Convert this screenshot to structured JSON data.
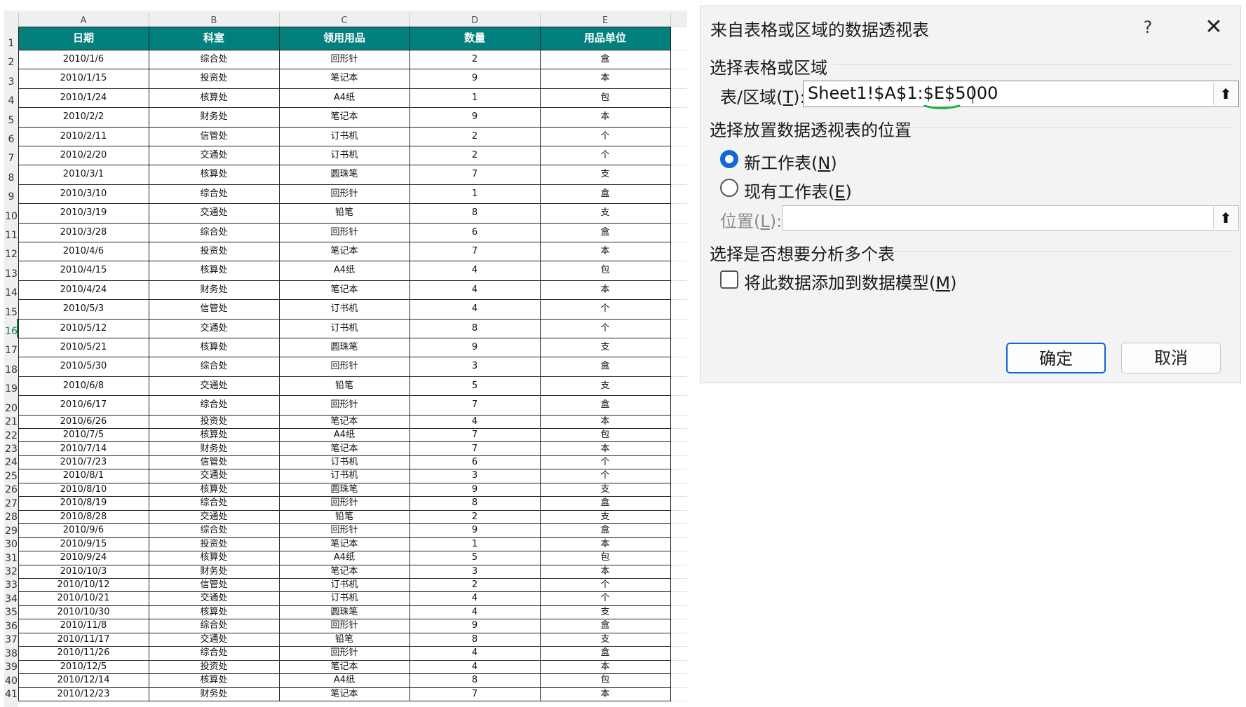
{
  "sheet": {
    "columns": [
      "A",
      "B",
      "C",
      "D",
      "E"
    ],
    "header": [
      "日期",
      "科室",
      "领用用品",
      "数量",
      "用品单位"
    ],
    "rows": [
      [
        "2010/1/6",
        "综合处",
        "回形针",
        "2",
        "盒"
      ],
      [
        "2010/1/15",
        "投资处",
        "笔记本",
        "9",
        "本"
      ],
      [
        "2010/1/24",
        "核算处",
        "A4纸",
        "1",
        "包"
      ],
      [
        "2010/2/2",
        "财务处",
        "笔记本",
        "9",
        "本"
      ],
      [
        "2010/2/11",
        "信管处",
        "订书机",
        "2",
        "个"
      ],
      [
        "2010/2/20",
        "交通处",
        "订书机",
        "2",
        "个"
      ],
      [
        "2010/3/1",
        "核算处",
        "圆珠笔",
        "7",
        "支"
      ],
      [
        "2010/3/10",
        "综合处",
        "回形针",
        "1",
        "盒"
      ],
      [
        "2010/3/19",
        "交通处",
        "铅笔",
        "8",
        "支"
      ],
      [
        "2010/3/28",
        "综合处",
        "回形针",
        "6",
        "盒"
      ],
      [
        "2010/4/6",
        "投资处",
        "笔记本",
        "7",
        "本"
      ],
      [
        "2010/4/15",
        "核算处",
        "A4纸",
        "4",
        "包"
      ],
      [
        "2010/4/24",
        "财务处",
        "笔记本",
        "4",
        "本"
      ],
      [
        "2010/5/3",
        "信管处",
        "订书机",
        "4",
        "个"
      ],
      [
        "2010/5/12",
        "交通处",
        "订书机",
        "8",
        "个"
      ],
      [
        "2010/5/21",
        "核算处",
        "圆珠笔",
        "9",
        "支"
      ],
      [
        "2010/5/30",
        "综合处",
        "回形针",
        "3",
        "盒"
      ],
      [
        "2010/6/8",
        "交通处",
        "铅笔",
        "5",
        "支"
      ],
      [
        "2010/6/17",
        "综合处",
        "回形针",
        "7",
        "盒"
      ],
      [
        "2010/6/26",
        "投资处",
        "笔记本",
        "4",
        "本"
      ],
      [
        "2010/7/5",
        "核算处",
        "A4纸",
        "7",
        "包"
      ],
      [
        "2010/7/14",
        "财务处",
        "笔记本",
        "7",
        "本"
      ],
      [
        "2010/7/23",
        "信管处",
        "订书机",
        "6",
        "个"
      ],
      [
        "2010/8/1",
        "交通处",
        "订书机",
        "3",
        "个"
      ],
      [
        "2010/8/10",
        "核算处",
        "圆珠笔",
        "9",
        "支"
      ],
      [
        "2010/8/19",
        "综合处",
        "回形针",
        "8",
        "盒"
      ],
      [
        "2010/8/28",
        "交通处",
        "铅笔",
        "2",
        "支"
      ],
      [
        "2010/9/6",
        "综合处",
        "回形针",
        "9",
        "盒"
      ],
      [
        "2010/9/15",
        "投资处",
        "笔记本",
        "1",
        "本"
      ],
      [
        "2010/9/24",
        "核算处",
        "A4纸",
        "5",
        "包"
      ],
      [
        "2010/10/3",
        "财务处",
        "笔记本",
        "3",
        "本"
      ],
      [
        "2010/10/12",
        "信管处",
        "订书机",
        "2",
        "个"
      ],
      [
        "2010/10/21",
        "交通处",
        "订书机",
        "4",
        "个"
      ],
      [
        "2010/10/30",
        "核算处",
        "圆珠笔",
        "4",
        "支"
      ],
      [
        "2010/11/8",
        "综合处",
        "回形针",
        "9",
        "盒"
      ],
      [
        "2010/11/17",
        "交通处",
        "铅笔",
        "8",
        "支"
      ],
      [
        "2010/11/26",
        "综合处",
        "回形针",
        "4",
        "盒"
      ],
      [
        "2010/12/5",
        "投资处",
        "笔记本",
        "4",
        "本"
      ],
      [
        "2010/12/14",
        "核算处",
        "A4纸",
        "8",
        "包"
      ],
      [
        "2010/12/23",
        "财务处",
        "笔记本",
        "7",
        "本"
      ]
    ],
    "active_row": "16",
    "header_color": "#03807d"
  },
  "dialog": {
    "title": "来自表格或区域的数据透视表",
    "help_label": "?",
    "close_label": "✕",
    "section_source": "选择表格或区域",
    "range_label_prefix": "表/区域(",
    "range_label_key": "T",
    "range_label_suffix": "):",
    "range_value": "Sheet1!$A$1:$E$5000",
    "collapse_icon": "⬆",
    "section_location": "选择放置数据透视表的位置",
    "new_sheet_prefix": "新工作表(",
    "new_sheet_key": "N",
    "new_sheet_suffix": ")",
    "existing_sheet_prefix": "现有工作表(",
    "existing_sheet_key": "E",
    "existing_sheet_suffix": ")",
    "location_label_prefix": "位置(",
    "location_label_key": "L",
    "location_label_suffix": "):",
    "location_value": "",
    "selected_option": "new_sheet",
    "section_multi": "选择是否想要分析多个表",
    "add_model_prefix": "将此数据添加到数据模型(",
    "add_model_key": "M",
    "add_model_suffix": ")",
    "add_model_checked": false,
    "ok_label": "确定",
    "cancel_label": "取消",
    "accent_color": "#1266d6",
    "annotation_color": "#22b14c"
  }
}
